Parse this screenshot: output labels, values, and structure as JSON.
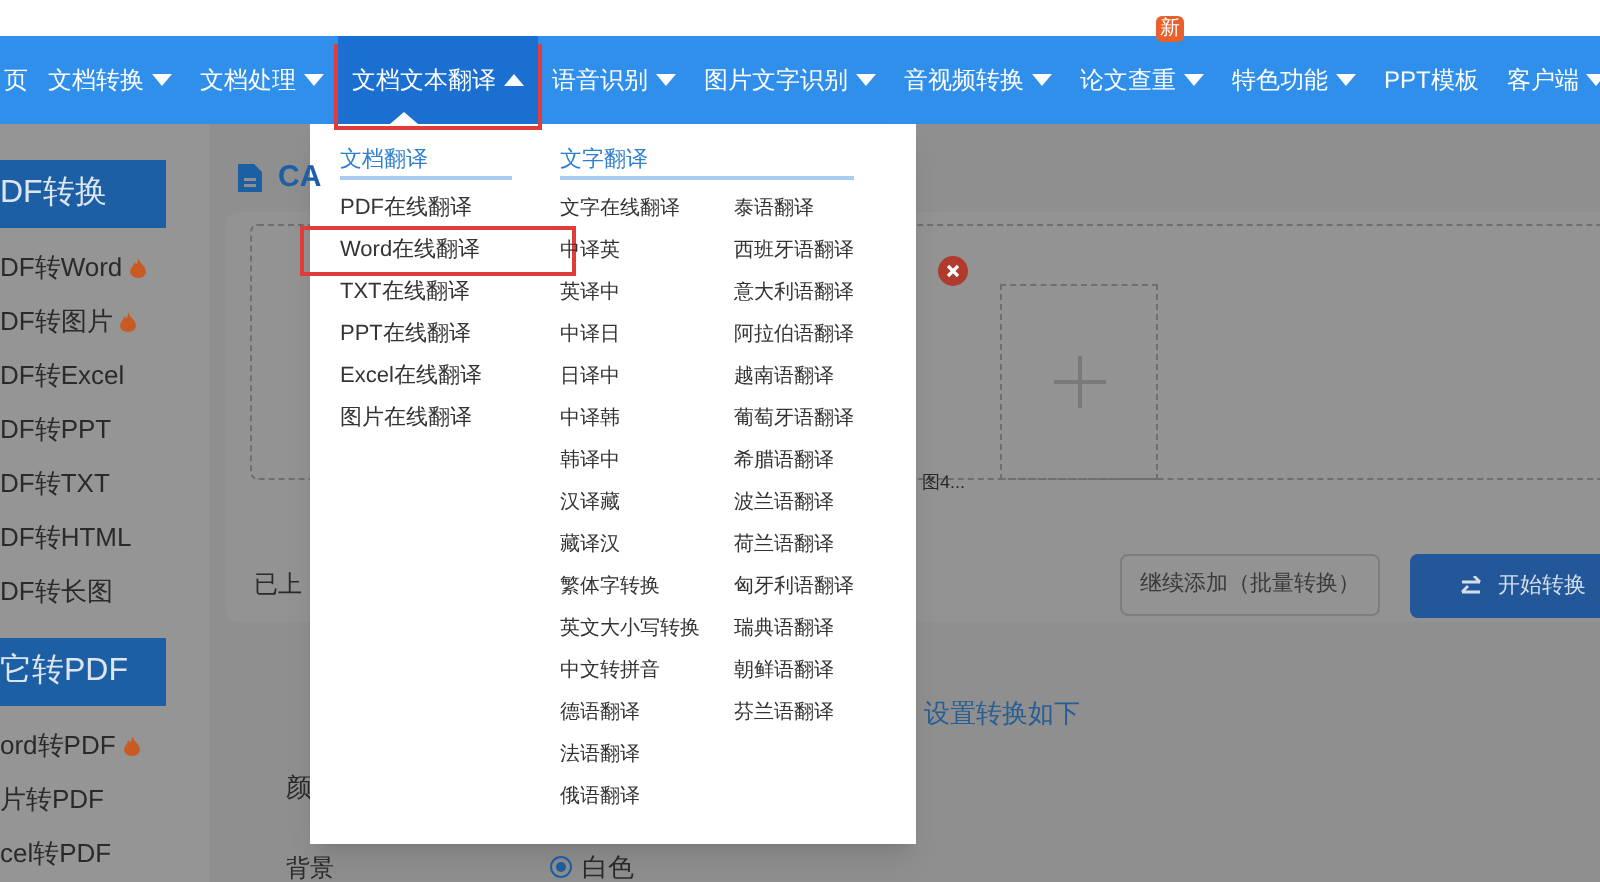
{
  "nav": {
    "items": [
      {
        "label": "页",
        "has_menu": false,
        "selected": false
      },
      {
        "label": "文档转换",
        "has_menu": true,
        "expanded": false,
        "selected": false
      },
      {
        "label": "文档处理",
        "has_menu": true,
        "expanded": false,
        "selected": false
      },
      {
        "label": "文档文本翻译",
        "has_menu": true,
        "expanded": true,
        "selected": true
      },
      {
        "label": "语音识别",
        "has_menu": true,
        "expanded": false,
        "selected": false
      },
      {
        "label": "图片文字识别",
        "has_menu": true,
        "expanded": false,
        "selected": false
      },
      {
        "label": "音视频转换",
        "has_menu": true,
        "expanded": false,
        "selected": false
      },
      {
        "label": "论文查重",
        "has_menu": true,
        "expanded": false,
        "selected": false,
        "badge": "新"
      },
      {
        "label": "特色功能",
        "has_menu": true,
        "expanded": false,
        "selected": false
      },
      {
        "label": "PPT模板",
        "has_menu": false,
        "selected": false
      },
      {
        "label": "客户端",
        "has_menu": true,
        "expanded": false,
        "selected": false
      }
    ]
  },
  "sidebar": {
    "groups": [
      {
        "heading": "DF转换",
        "items": [
          {
            "label": "DF转Word",
            "hot": true
          },
          {
            "label": "DF转图片",
            "hot": true
          },
          {
            "label": "DF转Excel",
            "hot": false
          },
          {
            "label": "DF转PPT",
            "hot": false
          },
          {
            "label": "DF转TXT",
            "hot": false
          },
          {
            "label": "DF转HTML",
            "hot": false
          },
          {
            "label": "DF转长图",
            "hot": false
          }
        ]
      },
      {
        "heading": "它转PDF",
        "items": [
          {
            "label": "ord转PDF",
            "hot": true
          },
          {
            "label": "片转PDF",
            "hot": false
          },
          {
            "label": "cel转PDF",
            "hot": false
          }
        ]
      }
    ]
  },
  "main": {
    "card_title": "CA",
    "file_caption": "图4...",
    "uploaded_text": "已上",
    "add_more_button": "继续添加（批量转换）",
    "start_button": "开始转换",
    "settings_link": "设置转换如下",
    "color_label": "颜",
    "background_label": "背景",
    "background_option": {
      "label": "白色",
      "selected": true
    }
  },
  "dropdown": {
    "doc_heading": "文档翻译",
    "doc_items": [
      {
        "label": "PDF在线翻译",
        "highlighted": false
      },
      {
        "label": "Word在线翻译",
        "highlighted": true
      },
      {
        "label": "TXT在线翻译",
        "highlighted": false
      },
      {
        "label": "PPT在线翻译",
        "highlighted": false
      },
      {
        "label": "Excel在线翻译",
        "highlighted": false
      },
      {
        "label": "图片在线翻译",
        "highlighted": false
      }
    ],
    "text_heading": "文字翻译",
    "text_items_col1": [
      "文字在线翻译",
      "中译英",
      "英译中",
      "中译日",
      "日译中",
      "中译韩",
      "韩译中",
      "汉译藏",
      "藏译汉",
      "繁体字转换",
      "英文大小写转换",
      "中文转拼音",
      "德语翻译",
      "法语翻译",
      "俄语翻译"
    ],
    "text_items_col2": [
      "泰语翻译",
      "西班牙语翻译",
      "意大利语翻译",
      "阿拉伯语翻译",
      "越南语翻译",
      "葡萄牙语翻译",
      "希腊语翻译",
      "波兰语翻译",
      "荷兰语翻译",
      "匈牙利语翻译",
      "瑞典语翻译",
      "朝鲜语翻译",
      "芬兰语翻译"
    ]
  }
}
